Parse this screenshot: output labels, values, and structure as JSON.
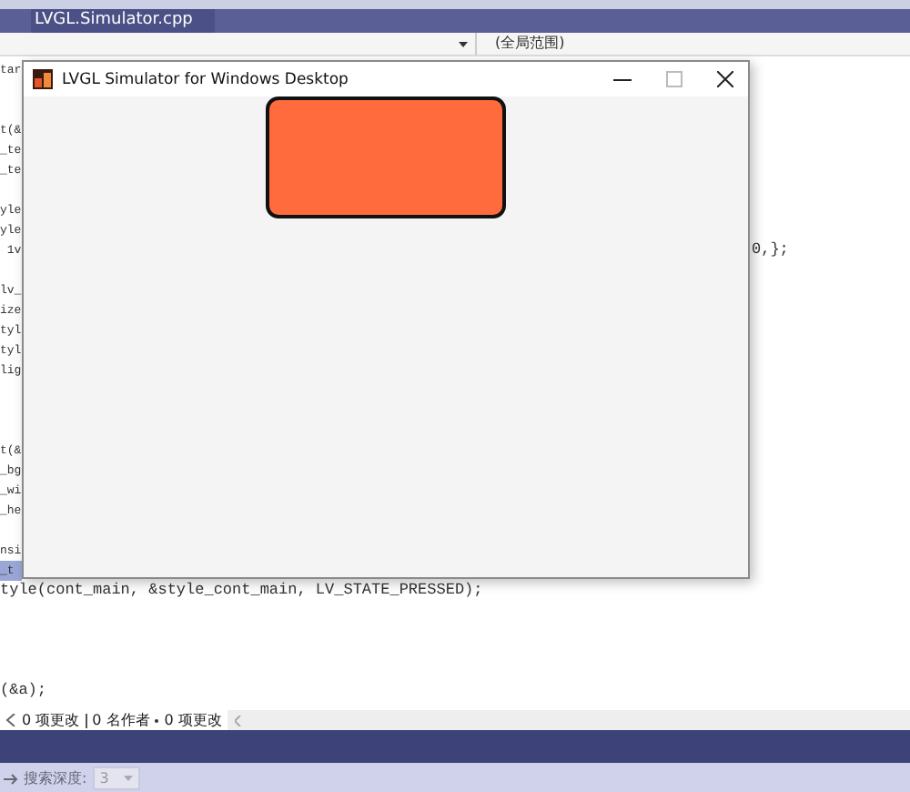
{
  "editor_tab": {
    "label": "LVGL.Simulator.cpp"
  },
  "scope_dropdown": {
    "value": "(全局范围)"
  },
  "code_lines": [
    {
      "text": "tar",
      "highlighted": false
    },
    {
      "highlighted": false
    },
    {
      "highlighted": false
    },
    {
      "text": "t(&",
      "highlighted": false
    },
    {
      "text": "_te",
      "highlighted": false
    },
    {
      "text": "_te",
      "highlighted": false
    },
    {
      "highlighted": false
    },
    {
      "text": "yle",
      "highlighted": false
    },
    {
      "text": "yle",
      "highlighted": false
    },
    {
      "text": " 1v",
      "tail": "0,};",
      "highlighted": false
    },
    {
      "highlighted": false
    },
    {
      "text": "lv_",
      "highlighted": false
    },
    {
      "text": "ize",
      "highlighted": false
    },
    {
      "text": "tyl",
      "highlighted": false
    },
    {
      "text": "tyl",
      "highlighted": false
    },
    {
      "text": "lig",
      "highlighted": false
    },
    {
      "highlighted": false
    },
    {
      "highlighted": false
    },
    {
      "highlighted": false
    },
    {
      "text": "t(&",
      "highlighted": false
    },
    {
      "text": "_bg",
      "highlighted": false
    },
    {
      "text": "_wi",
      "highlighted": false
    },
    {
      "text": "_he",
      "highlighted": false
    },
    {
      "highlighted": false
    },
    {
      "text": "nsi",
      "highlighted": false
    },
    {
      "text": "_t",
      "highlighted": true
    },
    {
      "text": "tyle(cont_main, &style_cont_main, LV_STATE_PRESSED);",
      "highlighted": false
    },
    {
      "highlighted": false
    },
    {
      "highlighted": false
    },
    {
      "highlighted": false
    },
    {
      "highlighted": false
    },
    {
      "text": "(&a);",
      "highlighted": false
    }
  ],
  "status_bar": {
    "changes": "0 项更改",
    "authors": "0 名作者",
    "pending": "0 项更改"
  },
  "find_bar": {
    "label": "搜索深度:",
    "depth": "3"
  },
  "simulator_window": {
    "title": "LVGL Simulator for Windows Desktop"
  }
}
